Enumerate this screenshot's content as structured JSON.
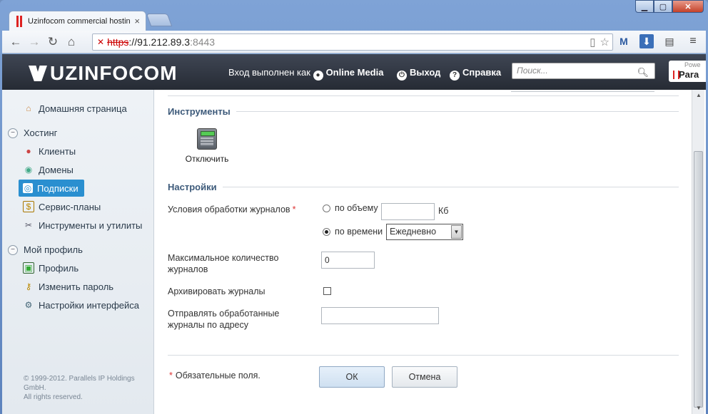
{
  "browser": {
    "tab_title": "Uzinfocom commercial hosting",
    "tab_close": "×",
    "window_min": "▁",
    "window_max": "▢",
    "window_close": "✕",
    "url_scheme": "https",
    "url_host": "://91.212.89.3",
    "url_port": ":8443"
  },
  "header": {
    "logo": "UZINFOCOM",
    "logged_in_prefix": "Вход выполнен как",
    "user_name": "Online Media",
    "logout_label": "Выход",
    "help_label": "Справка",
    "search_placeholder": "Поиск...",
    "parallels_powered": "Powe",
    "parallels_name": "Para"
  },
  "sidebar": {
    "home": "Домашняя страница",
    "hosting_section": "Хостинг",
    "hosting_items": [
      "Клиенты",
      "Домены",
      "Подписки",
      "Сервис-планы",
      "Инструменты и утилиты"
    ],
    "profile_section": "Мой профиль",
    "profile_items": [
      "Профиль",
      "Изменить пароль",
      "Настройки интерфейса"
    ],
    "copyright_1": "© 1999-2012. Parallels IP Holdings",
    "copyright_2": "GmbH.",
    "copyright_3": "All rights reserved."
  },
  "content": {
    "tools_title": "Инструменты",
    "tool_disable_label": "Отключить",
    "settings_title": "Настройки",
    "log_conditions_label": "Условия обработки журналов",
    "required_mark": "*",
    "by_size_label": "по объему",
    "size_value": "",
    "size_unit": "Кб",
    "by_time_label": "по времени",
    "period_selected": "Ежедневно",
    "max_logs_label_1": "Максимальное количество",
    "max_logs_label_2": "журналов",
    "max_logs_value": "0",
    "archive_label": "Архивировать журналы",
    "archive_checked": false,
    "send_logs_label_1": "Отправлять обработанные",
    "send_logs_label_2": "журналы по адресу",
    "send_logs_value": "",
    "required_note": "Обязательные поля.",
    "ok_label": "ОК",
    "cancel_label": "Отмена"
  },
  "colors": {
    "active_nav": "#2a8fd0",
    "header_bg": "#262b34",
    "section_title": "#3d5a7a",
    "required": "#dd3333"
  }
}
